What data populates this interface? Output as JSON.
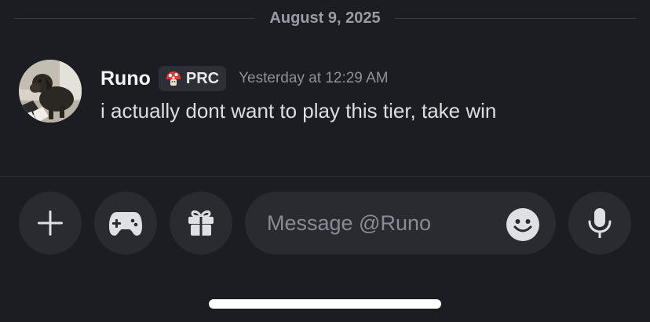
{
  "date_divider": {
    "label": "August 9, 2025"
  },
  "message": {
    "author": "Runo",
    "tag": {
      "label": "PRC",
      "icon": "mushroom-icon"
    },
    "timestamp": "Yesterday at 12:29 AM",
    "text": "i actually dont want to play this tier, take win"
  },
  "composer": {
    "placeholder": "Message @Runo",
    "buttons": [
      "plus-icon",
      "gamepad-icon",
      "gift-icon",
      "emoji-icon",
      "microphone-icon"
    ]
  },
  "colors": {
    "background": "#1c1d22",
    "surface": "#2a2b31",
    "icon": "#dfe0e4",
    "muted_text": "#8e9099"
  }
}
